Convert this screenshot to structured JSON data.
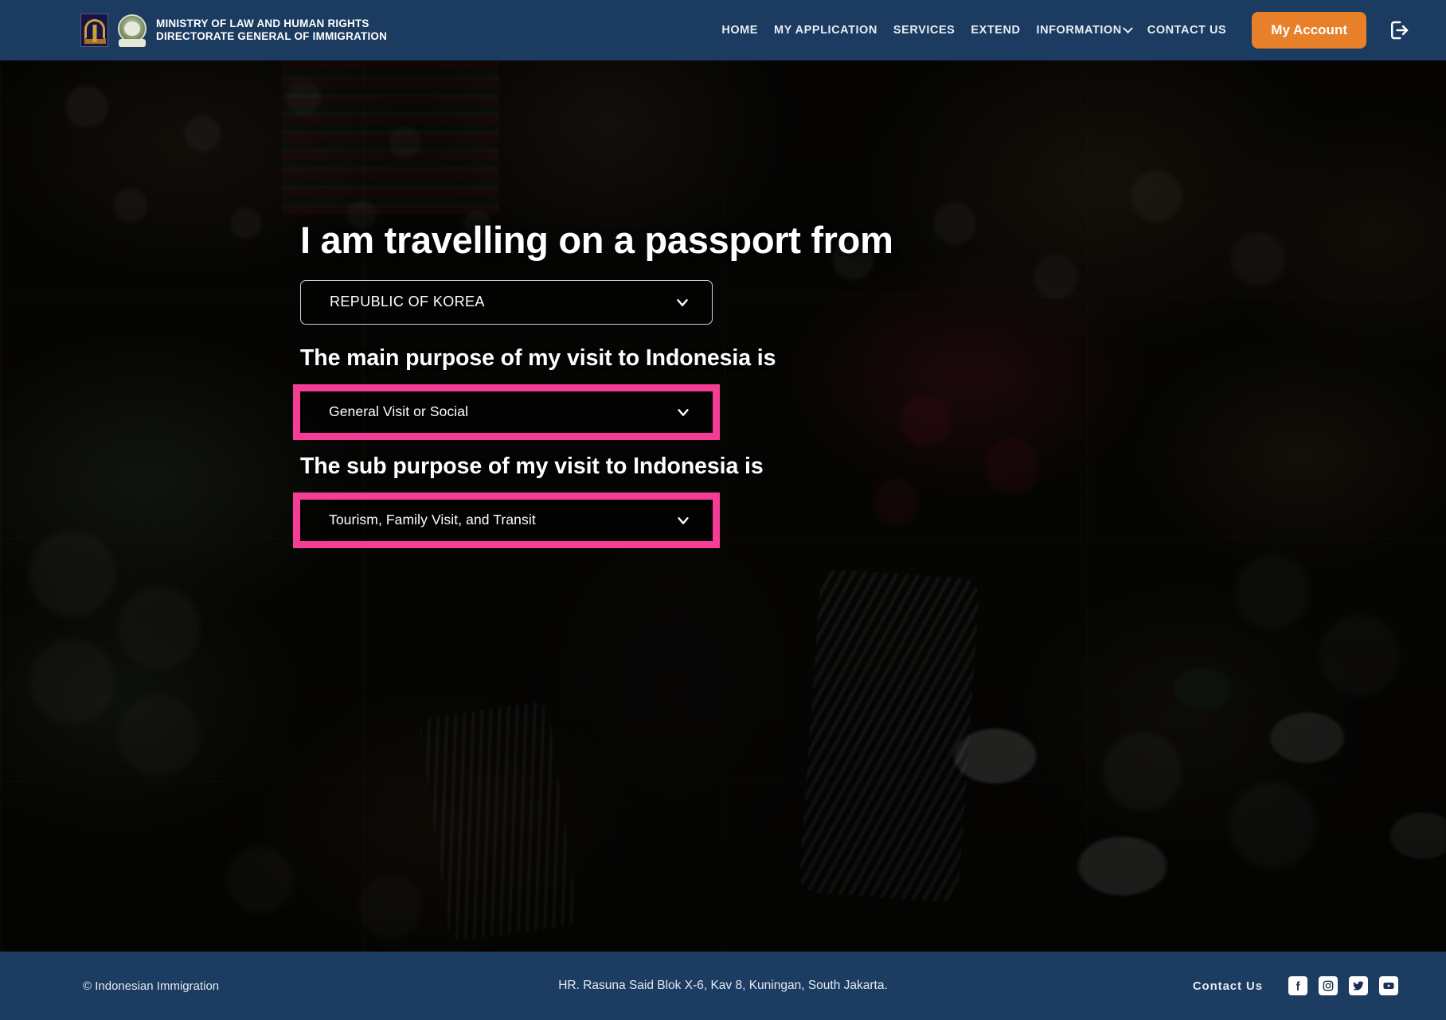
{
  "header": {
    "brand": {
      "line1": "MINISTRY OF  LAW  AND HUMAN RIGHTS",
      "line2": "DIRECTORATE GENERAL OF IMMIGRATION",
      "crest_law_name": "ministry-of-law-crest",
      "crest_immigration_name": "immigration-crest"
    },
    "nav": [
      {
        "label": "HOME",
        "has_caret": false
      },
      {
        "label": "MY APPLICATION",
        "has_caret": false
      },
      {
        "label": "SERVICES",
        "has_caret": false
      },
      {
        "label": "EXTEND",
        "has_caret": false
      },
      {
        "label": "INFORMATION",
        "has_caret": true
      },
      {
        "label": "CONTACT US",
        "has_caret": false
      }
    ],
    "account_button": "My Account",
    "logout_icon": "logout-icon",
    "bg_color": "#1b3c60",
    "accent_color": "#e8802a"
  },
  "hero": {
    "title": "I am travelling on a passport from",
    "country_select": {
      "value": "REPUBLIC OF KOREA",
      "highlighted": false
    },
    "main_purpose_label": "The main purpose of my visit to Indonesia is",
    "main_purpose_select": {
      "value": "General Visit or Social",
      "highlighted": true
    },
    "sub_purpose_label": "The sub purpose of my visit to Indonesia is",
    "sub_purpose_select": {
      "value": "Tourism, Family Visit, and Transit",
      "highlighted": true
    },
    "highlight_color": "#f53d96",
    "chevron_icon": "chevron-down-icon"
  },
  "footer": {
    "copyright": "© Indonesian Immigration",
    "address": "HR. Rasuna Said Blok X-6, Kav 8, Kuningan, South Jakarta.",
    "contact_label": "Contact Us",
    "social": [
      {
        "name": "facebook-icon"
      },
      {
        "name": "instagram-icon"
      },
      {
        "name": "twitter-icon"
      },
      {
        "name": "youtube-icon"
      }
    ],
    "bg_color": "#1c3c62"
  }
}
